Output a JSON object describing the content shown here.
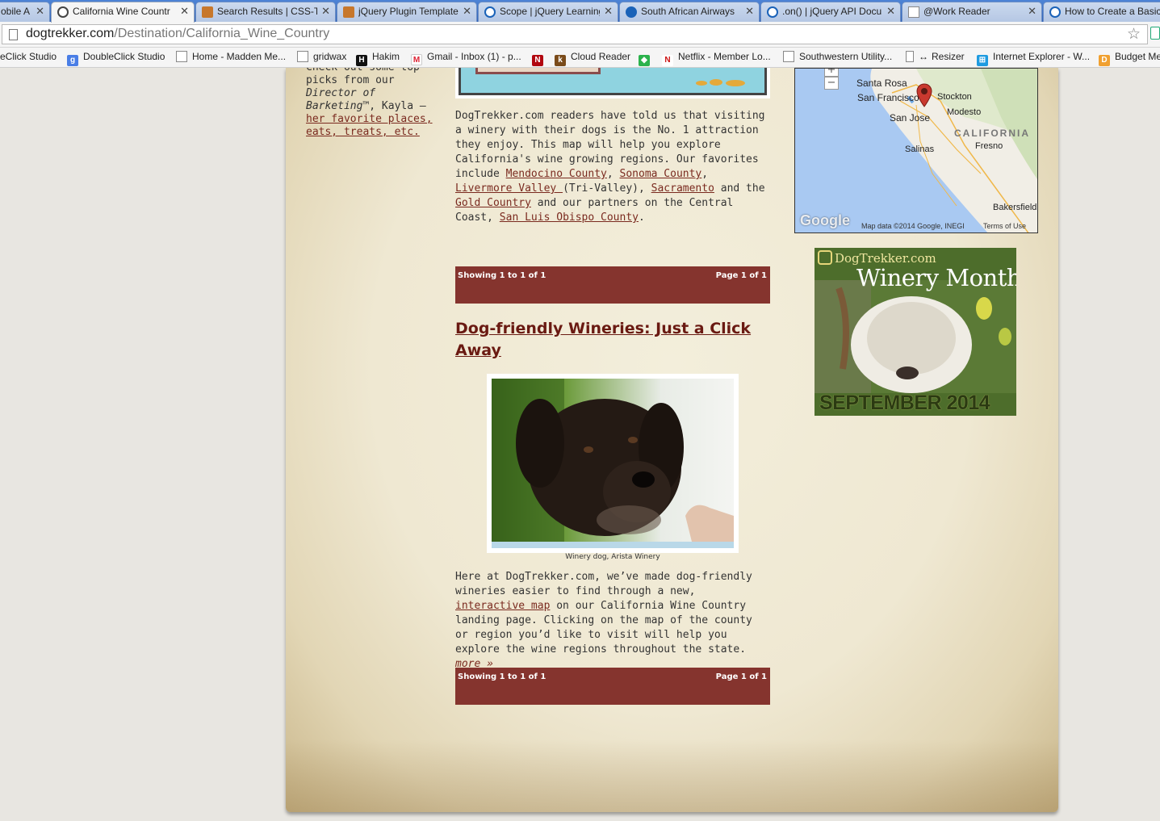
{
  "tabs": [
    {
      "label": "obile A",
      "icon": "globe-icon",
      "color": "#3b7bd8"
    },
    {
      "label": "California Wine Countr",
      "icon": "dogtrekker-favicon",
      "color": "#555555",
      "active": true
    },
    {
      "label": "Search Results | CSS-Tr",
      "icon": "css-tricks-favicon",
      "color": "#c7772b"
    },
    {
      "label": "jQuery Plugin Template",
      "icon": "css-tricks-favicon",
      "color": "#c7772b"
    },
    {
      "label": "Scope | jQuery Learning",
      "icon": "jquery-favicon",
      "color": "#1a62b8"
    },
    {
      "label": "South African Airways",
      "icon": "saa-favicon",
      "color": "#1a62b8"
    },
    {
      "label": ".on() | jQuery API Docu",
      "icon": "jquery-favicon",
      "color": "#1a62b8"
    },
    {
      "label": "@Work Reader",
      "icon": "page-icon",
      "color": "#ffffff"
    },
    {
      "label": "How to Create a Basic",
      "icon": "jquery-favicon",
      "color": "#1a62b8"
    }
  ],
  "address": {
    "domain": "dogtrekker.com",
    "path": "/Destination/California_Wine_Country"
  },
  "bookmarks": [
    {
      "label": "eClick Studio",
      "icon": "none"
    },
    {
      "label": "DoubleClick Studio",
      "icon": "google-icon",
      "color": "#4a7ee6",
      "glyph": "g"
    },
    {
      "label": "Home - Madden Me...",
      "icon": "page-icon"
    },
    {
      "label": "gridwax",
      "icon": "page-icon"
    },
    {
      "label": "Hakim",
      "icon": "h-icon",
      "color": "#111111",
      "glyph": "H"
    },
    {
      "label": "Gmail - Inbox (1) - p...",
      "icon": "gmail-icon",
      "color": "#ffffff",
      "glyph": "M"
    },
    {
      "label": "",
      "icon": "netflix-icon",
      "color": "#b1060f",
      "glyph": "N"
    },
    {
      "label": "Cloud Reader",
      "icon": "kindle-icon",
      "color": "#7a4b1a",
      "glyph": "k"
    },
    {
      "label": "",
      "icon": "feedly-icon",
      "color": "#2bb24c",
      "glyph": "◆"
    },
    {
      "label": "Netflix - Member Lo...",
      "icon": "netflix-n-icon",
      "color": "#ffffff",
      "glyph": "N"
    },
    {
      "label": "Southwestern Utility...",
      "icon": "page-icon"
    },
    {
      "label": "Resizer",
      "icon": "resize-icon",
      "glyph": "↔"
    },
    {
      "label": "Internet Explorer - W...",
      "icon": "windows-icon",
      "color": "#1f9be0",
      "glyph": "⊞"
    },
    {
      "label": "Budget Me",
      "icon": "budget-icon",
      "color": "#f0a030",
      "glyph": "D"
    }
  ],
  "left_column": {
    "text_1": "Check out some top picks from our ",
    "text_italic": "Director of Barketing",
    "text_2": "™, Kayla — ",
    "link": "her favorite places, eats, treats, etc."
  },
  "intro": {
    "p1": "DogTrekker.com readers have told us that visiting a winery with their dogs is the No. 1 attraction they enjoy. This map will help you explore California's wine growing regions. Our favorites include ",
    "link_mendocino": "Mendocino County",
    "sep1": ", ",
    "link_sonoma": "Sonoma County",
    "sep2": ", ",
    "link_livermore": "Livermore Valley ",
    "p2": "(Tri-Valley), ",
    "link_sacramento": "Sacramento",
    "p3": " and the ",
    "link_gold": "Gold Country",
    "p4": " and our partners on the Central Coast, ",
    "link_slo": "San Luis Obispo County",
    "p5": "."
  },
  "pager": {
    "showing": "Showing 1 to 1 of 1",
    "page": "Page 1 of 1"
  },
  "article": {
    "title": "Dog-friendly Wineries: Just a Click Away",
    "caption": "Winery dog, Arista Winery",
    "body_1": "Here at DogTrekker.com, we’ve made dog-friendly wineries easier to find through a new, ",
    "link": "interactive map",
    "body_2": " on our California Wine Country landing page. Clicking on the map of the county or region you’d like to visit will help you explore the wine regions throughout the state. ",
    "more": "more »"
  },
  "map": {
    "cities": [
      "Santa Rosa",
      "San Francisco",
      "Stockton",
      "Modesto",
      "San Jose",
      "Fresno",
      "Salinas",
      "Bakersfield"
    ],
    "state": "CALIFORNIA",
    "logo": "Google",
    "attribution": "Map data ©2014 Google, INEGI",
    "terms": "Terms of Use",
    "zoom_in": "+",
    "zoom_out": "−"
  },
  "ad": {
    "brand": "DogTrekker.com",
    "title": "Winery Month",
    "month": "SEPTEMBER 2014"
  },
  "colors": {
    "pager_bg": "#85342e",
    "link": "#7a2a1f",
    "headline": "#6a1a12",
    "ad_green": "#4d6d2b"
  }
}
